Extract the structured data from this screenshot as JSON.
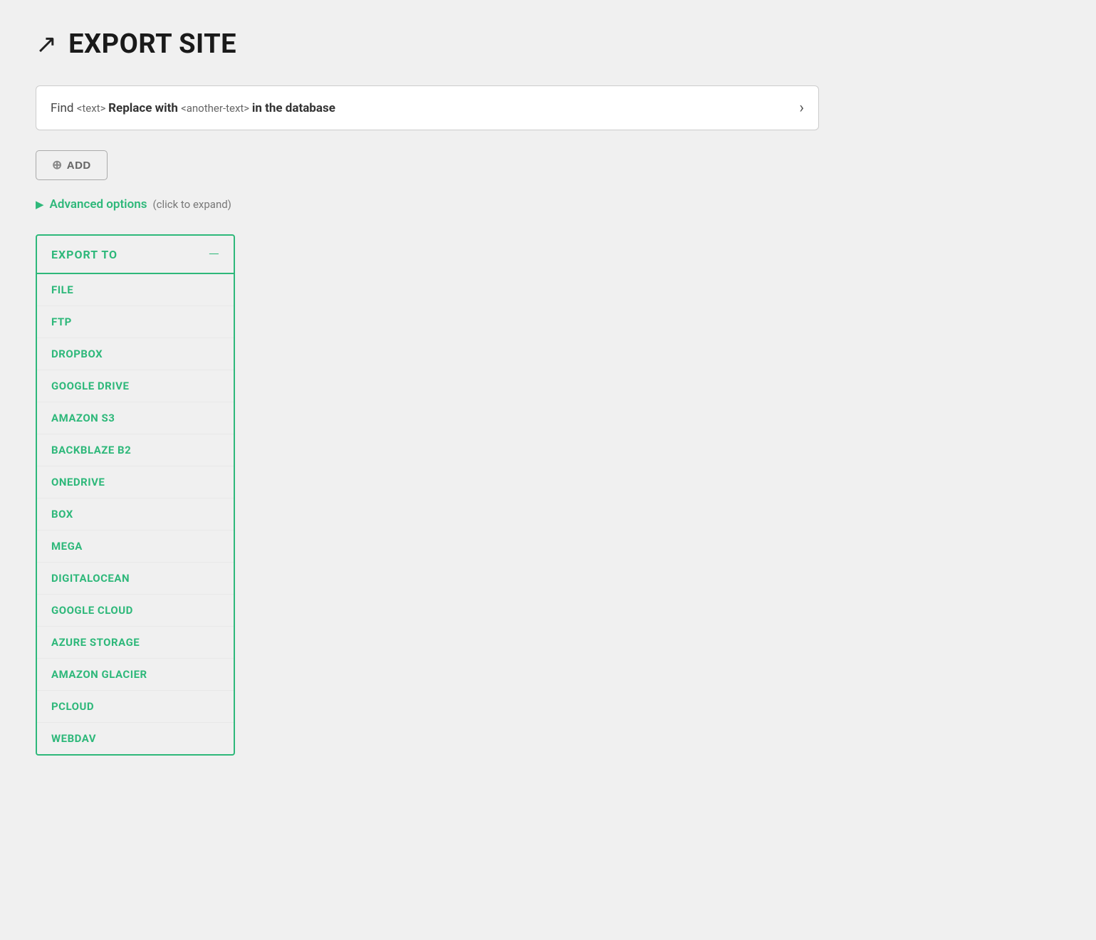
{
  "header": {
    "icon": "↗",
    "title": "EXPORT SITE"
  },
  "find_replace_bar": {
    "find_label": "Find",
    "find_code": "<text>",
    "replace_label": "Replace with",
    "replace_code": "<another-text>",
    "suffix": "in the database",
    "arrow": "›"
  },
  "add_button": {
    "label": "ADD",
    "icon": "⊕"
  },
  "advanced_options": {
    "arrow": "▶",
    "label": "Advanced options",
    "hint": "(click to expand)"
  },
  "export_panel": {
    "title": "EXPORT TO",
    "collapse_icon": "—",
    "options": [
      {
        "label": "FILE"
      },
      {
        "label": "FTP"
      },
      {
        "label": "DROPBOX"
      },
      {
        "label": "GOOGLE DRIVE"
      },
      {
        "label": "AMAZON S3"
      },
      {
        "label": "BACKBLAZE B2"
      },
      {
        "label": "ONEDRIVE"
      },
      {
        "label": "BOX"
      },
      {
        "label": "MEGA"
      },
      {
        "label": "DIGITALOCEAN"
      },
      {
        "label": "GOOGLE CLOUD"
      },
      {
        "label": "AZURE STORAGE"
      },
      {
        "label": "AMAZON GLACIER"
      },
      {
        "label": "PCLOUD"
      },
      {
        "label": "WEBDAV"
      }
    ]
  }
}
